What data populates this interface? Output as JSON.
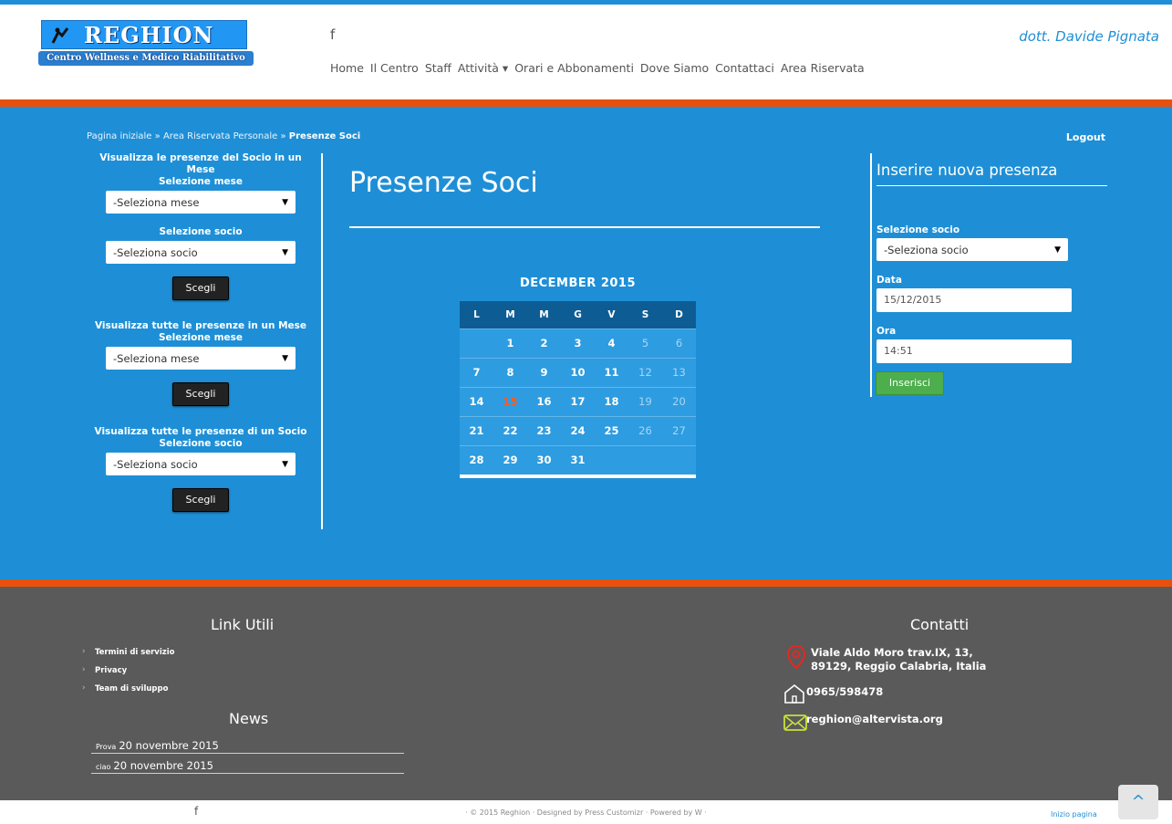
{
  "header": {
    "logo_title": "REGHION",
    "logo_subtitle": "Centro Wellness e Medico Riabilitativo",
    "facebook_icon": "f",
    "doctor_name": "dott. Davide Pignata",
    "nav": [
      "Home",
      "Il Centro",
      "Staff",
      "Attività ▾",
      "Orari e Abbonamenti",
      "Dove Siamo",
      "Contattaci",
      "Area Riservata"
    ]
  },
  "breadcrumb": {
    "home": "Pagina iniziale",
    "sep": "»",
    "area": "Area Riservata Personale",
    "current": "Presenze Soci"
  },
  "logout": "Logout",
  "left_panel": {
    "section1_title": "Visualizza le presenze del Socio in un Mese",
    "section1_month_label": "Selezione mese",
    "section1_month_value": "-Seleziona mese",
    "section1_member_label": "Selezione socio",
    "section1_member_value": "-Seleziona socio",
    "section2_title": "Visualizza tutte le presenze in un Mese",
    "section2_month_label": "Selezione mese",
    "section2_month_value": "-Seleziona mese",
    "section3_title": "Visualizza tutte le presenze di un Socio",
    "section3_member_label": "Selezione socio",
    "section3_member_value": "-Seleziona socio",
    "choose_button": "Scegli"
  },
  "page_title": "Presenze Soci",
  "calendar": {
    "caption": "DECEMBER 2015",
    "weekdays": [
      "L",
      "M",
      "M",
      "G",
      "V",
      "S",
      "D"
    ],
    "weeks": [
      [
        "",
        "1",
        "2",
        "3",
        "4",
        "5",
        "6"
      ],
      [
        "7",
        "8",
        "9",
        "10",
        "11",
        "12",
        "13"
      ],
      [
        "14",
        "15",
        "16",
        "17",
        "18",
        "19",
        "20"
      ],
      [
        "21",
        "22",
        "23",
        "24",
        "25",
        "26",
        "27"
      ],
      [
        "28",
        "29",
        "30",
        "31",
        "",
        "",
        ""
      ]
    ],
    "today": "15"
  },
  "right_panel": {
    "title": "Inserire nuova presenza",
    "member_label": "Selezione socio",
    "member_value": "-Seleziona socio",
    "date_label": "Data",
    "date_value": "15/12/2015",
    "time_label": "Ora",
    "time_value": "14:51",
    "submit": "Inserisci"
  },
  "footer": {
    "links_title": "Link Utili",
    "links": [
      "Termini di servizio",
      "Privacy",
      "Team di sviluppo"
    ],
    "news_title": "News",
    "news": [
      {
        "title": "Prova",
        "date": "20 novembre 2015"
      },
      {
        "title": "ciao",
        "date": "20 novembre 2015"
      }
    ],
    "contacts_title": "Contatti",
    "address_line1": "Viale Aldo Moro trav.IX, 13,",
    "address_line2": "89129, Reggio Calabria, Italia",
    "phone": "0965/598478",
    "email": "reghion@altervista.org"
  },
  "bottom": {
    "facebook_icon": "f",
    "copyright": "· © 2015 Reghion · Designed by Press Customizr · Powered by W ·",
    "back_to_top": "Inizio pagina",
    "scroll_top_icon": "^"
  },
  "colors": {
    "primary_blue": "#1e8fd6",
    "accent_orange": "#e8500f",
    "footer_gray": "#5a5a5a",
    "success_green": "#4cae4c"
  }
}
